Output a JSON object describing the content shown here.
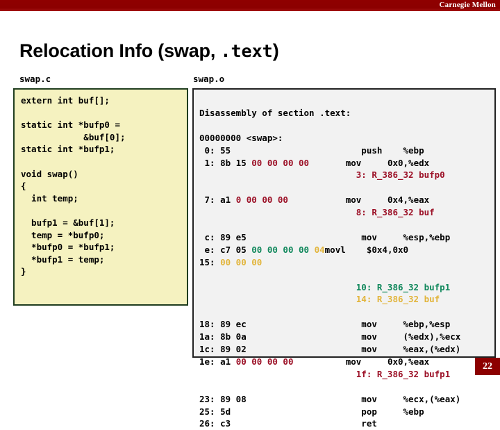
{
  "banner": {
    "brand": "Carnegie Mellon",
    "color": "#8c0000"
  },
  "title": {
    "prefix": "Relocation Info (swap, ",
    "mono": ".text",
    "suffix": ")"
  },
  "captions": {
    "left": "swap.c",
    "right": "swap.o"
  },
  "colors": {
    "relocation_red": "#9c1127",
    "relocation_green": "#11885c",
    "relocation_gold": "#e2b53c",
    "left_panel_bg": "#f5f2c0",
    "left_panel_border": "#1f3d1f",
    "right_panel_bg": "#f2f2f2",
    "right_panel_border": "#222222"
  },
  "source_panel": {
    "lines": [
      "extern int buf[];",
      "",
      "static int *bufp0 =",
      "            &buf[0];",
      "static int *bufp1;",
      "",
      "void swap()",
      "{",
      "  int temp;",
      "",
      "  bufp1 = &buf[1];",
      "  temp = *bufp0;",
      "  *bufp0 = *bufp1;",
      "  *bufp1 = temp;",
      "}"
    ]
  },
  "disassembly_panel": {
    "header": "Disassembly of section .text:",
    "symbol_line": "00000000 <swap>:",
    "lines": [
      {
        "type": "blank"
      },
      {
        "type": "text",
        "segments": [
          {
            "t": "Disassembly of section .text:",
            "c": "plain"
          }
        ]
      },
      {
        "type": "blank"
      },
      {
        "type": "text",
        "segments": [
          {
            "t": "00000000 <swap>:",
            "c": "plain"
          }
        ]
      },
      {
        "type": "text",
        "segments": [
          {
            "t": " 0: 55                         push    %ebp",
            "c": "plain"
          }
        ]
      },
      {
        "type": "text",
        "segments": [
          {
            "t": " 1: 8b 15 ",
            "c": "plain"
          },
          {
            "t": "00 00 00 00",
            "c": "red"
          },
          {
            "t": "       mov     0x0,%edx",
            "c": "plain"
          }
        ]
      },
      {
        "type": "text",
        "segments": [
          {
            "t": "                              3: R_386_32 bufp0",
            "c": "red"
          }
        ]
      },
      {
        "type": "blank"
      },
      {
        "type": "text",
        "segments": [
          {
            "t": " 7: a1 ",
            "c": "plain"
          },
          {
            "t": "0 00 00 00",
            "c": "red"
          },
          {
            "t": "           mov     0x4,%eax",
            "c": "plain"
          }
        ]
      },
      {
        "type": "text",
        "segments": [
          {
            "t": "                              8: R_386_32 buf",
            "c": "red"
          }
        ]
      },
      {
        "type": "blank"
      },
      {
        "type": "text",
        "segments": [
          {
            "t": " c: 89 e5                      mov     %esp,%ebp",
            "c": "plain"
          }
        ]
      },
      {
        "type": "text",
        "segments": [
          {
            "t": " e: c7 05 ",
            "c": "plain"
          },
          {
            "t": "00 00 00 00 ",
            "c": "green"
          },
          {
            "t": "04",
            "c": "gold"
          },
          {
            "t": "movl    $0x4,0x0",
            "c": "plain"
          }
        ]
      },
      {
        "type": "text",
        "segments": [
          {
            "t": "15: ",
            "c": "plain"
          },
          {
            "t": "00 00 00",
            "c": "gold"
          }
        ]
      },
      {
        "type": "blank"
      },
      {
        "type": "text",
        "segments": [
          {
            "t": "                              10: R_386_32 bufp1",
            "c": "green"
          }
        ]
      },
      {
        "type": "text",
        "segments": [
          {
            "t": "                              14: R_386_32 buf",
            "c": "gold"
          }
        ]
      },
      {
        "type": "blank"
      },
      {
        "type": "text",
        "segments": [
          {
            "t": "18: 89 ec                      mov     %ebp,%esp",
            "c": "plain"
          }
        ]
      },
      {
        "type": "text",
        "segments": [
          {
            "t": "1a: 8b 0a                      mov     (%edx),%ecx",
            "c": "plain"
          }
        ]
      },
      {
        "type": "text",
        "segments": [
          {
            "t": "1c: 89 02                      mov     %eax,(%edx)",
            "c": "plain"
          }
        ]
      },
      {
        "type": "text",
        "segments": [
          {
            "t": "1e: a1 ",
            "c": "plain"
          },
          {
            "t": "00 00 00 00",
            "c": "red"
          },
          {
            "t": "          mov     0x0,%eax",
            "c": "plain"
          }
        ]
      },
      {
        "type": "text",
        "segments": [
          {
            "t": "                              1f: R_386_32 bufp1",
            "c": "red"
          }
        ]
      },
      {
        "type": "blank"
      },
      {
        "type": "text",
        "segments": [
          {
            "t": "23: 89 08                      mov     %ecx,(%eax)",
            "c": "plain"
          }
        ]
      },
      {
        "type": "text",
        "segments": [
          {
            "t": "25: 5d                         pop     %ebp",
            "c": "plain"
          }
        ]
      },
      {
        "type": "text",
        "segments": [
          {
            "t": "26: c3                         ret",
            "c": "plain"
          }
        ]
      }
    ]
  },
  "page_number": "22"
}
